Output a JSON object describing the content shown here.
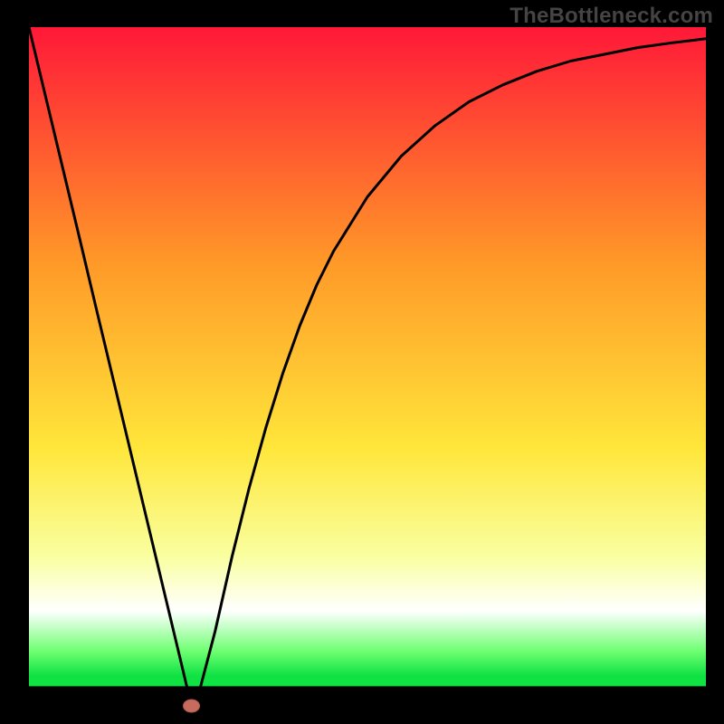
{
  "watermark": "TheBottleneck.com",
  "colors": {
    "red_top": "#ff1838",
    "orange": "#ff9a28",
    "yellow": "#ffe63a",
    "pale_yellow": "#f9ffa0",
    "white": "#ffffff",
    "lime": "#6cff70",
    "green": "#10e244",
    "black": "#000000",
    "curve": "#000000",
    "marker_fill": "#c66b5e",
    "marker_stroke": "#b25a4e"
  },
  "chart_data": {
    "type": "line",
    "title": "",
    "xlabel": "",
    "ylabel": "",
    "xlim": [
      0,
      100
    ],
    "ylim": [
      0,
      100
    ],
    "series": [
      {
        "name": "bottleneck-curve",
        "x": [
          0,
          2.5,
          5,
          7.5,
          10,
          12.5,
          15,
          17.5,
          20,
          22.5,
          24,
          25,
          27.5,
          30,
          32.5,
          35,
          37.5,
          40,
          42.5,
          45,
          47.5,
          50,
          55,
          60,
          65,
          70,
          75,
          80,
          85,
          90,
          95,
          100
        ],
        "y": [
          100,
          89.6,
          79.2,
          68.8,
          58.3,
          47.9,
          37.5,
          27.1,
          16.7,
          6.3,
          0,
          1.5,
          11,
          22,
          32,
          41,
          49,
          56,
          62,
          67,
          71,
          75,
          81,
          85.5,
          89,
          91.5,
          93.5,
          95,
          96,
          97,
          97.7,
          98.3
        ]
      }
    ],
    "marker": {
      "x": 24,
      "y": 0
    }
  }
}
